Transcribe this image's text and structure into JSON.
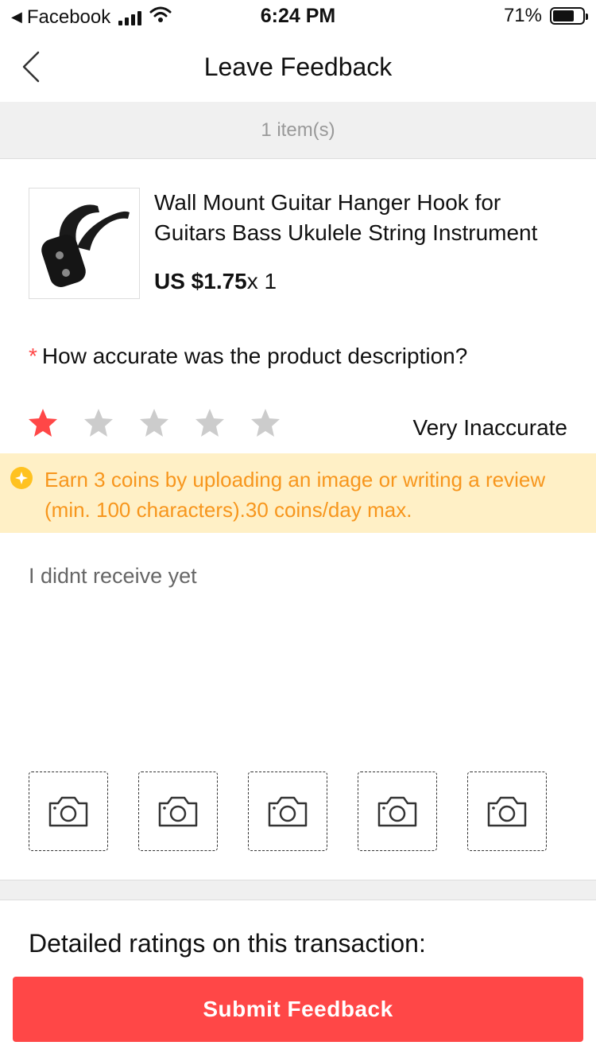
{
  "status_bar": {
    "back_app": "Facebook",
    "time": "6:24 PM",
    "battery_percent": "71%",
    "battery_level": 0.71,
    "signal_bars": 4,
    "icons": [
      "back-arrow-icon",
      "signal-icon",
      "wifi-icon",
      "battery-icon"
    ]
  },
  "nav": {
    "title": "Leave Feedback",
    "back_icon": "chevron-left-icon"
  },
  "items_count": "1 item(s)",
  "product": {
    "title": "Wall Mount Guitar Hanger Hook for Guitars Bass Ukulele String Instrument",
    "price": "US $1.75",
    "quantity": "x 1",
    "image_icon": "guitar-hanger-image"
  },
  "question": {
    "required_mark": "*",
    "text": "How accurate was the product description?"
  },
  "rating": {
    "value": 1,
    "max": 5,
    "label": "Very Inaccurate",
    "active_color": "#ff4747",
    "inactive_color": "#cccccc"
  },
  "coins_banner": {
    "text": "Earn 3 coins by uploading an image or writing a review (min. 100 characters).30 coins/day max.",
    "icon": "coin-icon",
    "background": "#fff0c6",
    "text_color": "#f7961d"
  },
  "review": {
    "value": "I didnt receive yet"
  },
  "photo_slots": {
    "count": 5,
    "icon": "camera-icon"
  },
  "detailed_ratings_heading": "Detailed ratings on this transaction:",
  "submit": {
    "label": "Submit Feedback",
    "color": "#ff4747"
  }
}
